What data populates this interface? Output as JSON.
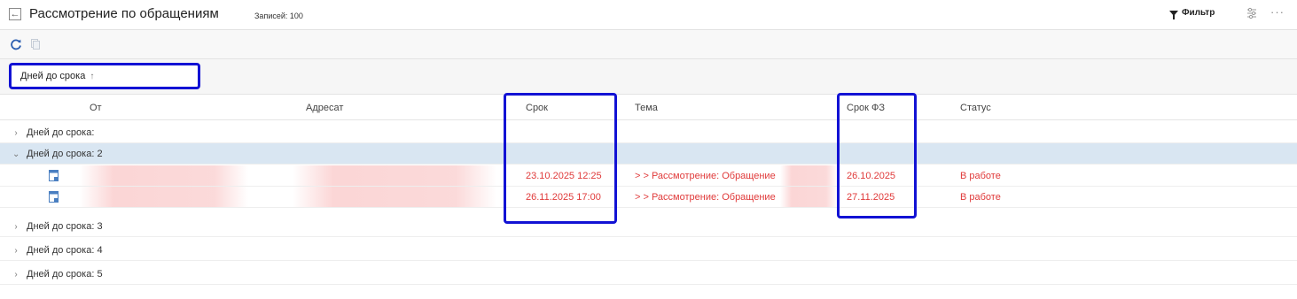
{
  "header": {
    "title": "Рассмотрение по обращениям",
    "count_label": "Записей: 100",
    "filter_label": "Фильтр",
    "back_icon": "arrow-left-icon",
    "more_label": "···"
  },
  "toolbar": {
    "refresh_icon": "refresh-icon",
    "copy_icon": "copy-icon"
  },
  "grouping": {
    "label": "Дней до срока",
    "sort_glyph": "↑"
  },
  "columns": {
    "from": "От",
    "addressee": "Адресат",
    "deadline": "Срок",
    "subject": "Тема",
    "deadline_fz": "Срок ФЗ",
    "status": "Статус"
  },
  "groups": [
    {
      "label": "Дней до срока:",
      "expanded": false
    },
    {
      "label": "Дней до срока: 2",
      "expanded": true
    },
    {
      "label": "Дней до срока: 3",
      "expanded": false
    },
    {
      "label": "Дней до срока: 4",
      "expanded": false
    },
    {
      "label": "Дней до срока: 5",
      "expanded": false
    }
  ],
  "rows": [
    {
      "deadline": "23.10.2025 12:25",
      "subject": "> > Рассмотрение: Обращение",
      "deadline_fz": "26.10.2025",
      "status": "В работе"
    },
    {
      "deadline": "26.11.2025 17:00",
      "subject": "> > Рассмотрение: Обращение",
      "deadline_fz": "27.11.2025",
      "status": "В работе"
    }
  ],
  "colors": {
    "highlight": "#1212d4",
    "overdue_text": "#e03a3a",
    "selected_row": "#d9e6f2"
  }
}
